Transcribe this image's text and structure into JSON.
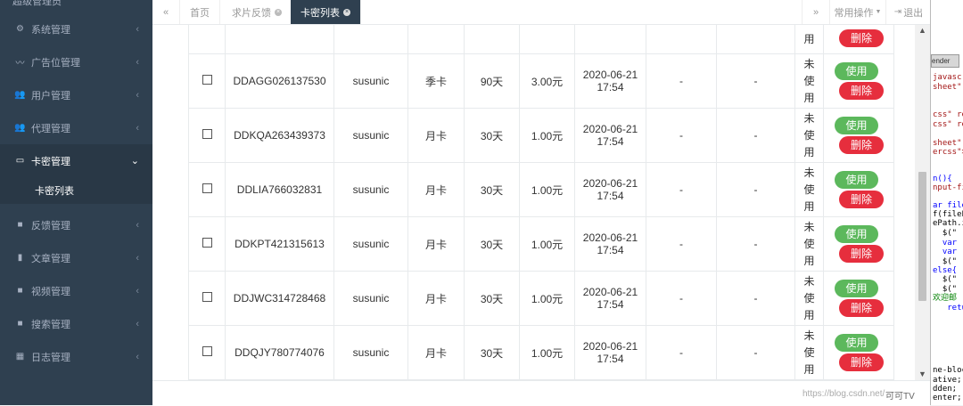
{
  "sidebar": {
    "logo_text": "超级管理员",
    "items": [
      {
        "label": "系统管理",
        "icon": "gears-icon"
      },
      {
        "label": "广告位管理",
        "icon": "rss-icon"
      },
      {
        "label": "用户管理",
        "icon": "users-icon"
      },
      {
        "label": "代理管理",
        "icon": "users-icon"
      },
      {
        "label": "卡密管理",
        "icon": "credit-card-icon"
      },
      {
        "label": "反馈管理",
        "icon": "video-icon"
      },
      {
        "label": "文章管理",
        "icon": "book-icon"
      },
      {
        "label": "视频管理",
        "icon": "video-icon"
      },
      {
        "label": "搜索管理",
        "icon": "video-icon"
      },
      {
        "label": "日志管理",
        "icon": "table-icon"
      }
    ],
    "sub_item": "卡密列表"
  },
  "topbar": {
    "prev_icon": "«",
    "next_icon": "»",
    "tabs": [
      "首页",
      "求片反馈",
      "卡密列表"
    ],
    "ops_label": "常用操作",
    "logout_label": "退出"
  },
  "table": {
    "first_row_partial": {
      "status": "用",
      "delete": "删除"
    },
    "rows": [
      {
        "code": "DDAGG026137530",
        "user": "susunic",
        "type": "季卡",
        "days": "90天",
        "price": "3.00元",
        "date": "2020-06-21",
        "time": "17:54",
        "c1": "-",
        "c2": "-",
        "status": [
          "未",
          "使",
          "用"
        ],
        "use": "使用",
        "delete": "删除"
      },
      {
        "code": "DDKQA263439373",
        "user": "susunic",
        "type": "月卡",
        "days": "30天",
        "price": "1.00元",
        "date": "2020-06-21",
        "time": "17:54",
        "c1": "-",
        "c2": "-",
        "status": [
          "未",
          "使",
          "用"
        ],
        "use": "使用",
        "delete": "删除"
      },
      {
        "code": "DDLIA766032831",
        "user": "susunic",
        "type": "月卡",
        "days": "30天",
        "price": "1.00元",
        "date": "2020-06-21",
        "time": "17:54",
        "c1": "-",
        "c2": "-",
        "status": [
          "未",
          "使",
          "用"
        ],
        "use": "使用",
        "delete": "删除"
      },
      {
        "code": "DDKPT421315613",
        "user": "susunic",
        "type": "月卡",
        "days": "30天",
        "price": "1.00元",
        "date": "2020-06-21",
        "time": "17:54",
        "c1": "-",
        "c2": "-",
        "status": [
          "未",
          "使",
          "用"
        ],
        "use": "使用",
        "delete": "删除"
      },
      {
        "code": "DDJWC314728468",
        "user": "susunic",
        "type": "月卡",
        "days": "30天",
        "price": "1.00元",
        "date": "2020-06-21",
        "time": "17:54",
        "c1": "-",
        "c2": "-",
        "status": [
          "未",
          "使",
          "用"
        ],
        "use": "使用",
        "delete": "删除"
      },
      {
        "code": "DDQJY780774076",
        "user": "susunic",
        "type": "月卡",
        "days": "30天",
        "price": "1.00元",
        "date": "2020-06-21",
        "time": "17:54",
        "c1": "-",
        "c2": "-",
        "status": [
          "未",
          "使",
          "用"
        ],
        "use": "使用",
        "delete": "删除"
      }
    ]
  },
  "editor": {
    "tab_label": "ender",
    "lines": [
      {
        "text": "javascr",
        "cls": "c-red"
      },
      {
        "text": "sheet\" t",
        "cls": "c-red"
      },
      {
        "text": "css\" re",
        "cls": "c-red"
      },
      {
        "text": "css\" re",
        "cls": "c-red"
      },
      {
        "text": "",
        "cls": "c-black"
      },
      {
        "text": "sheet\" h",
        "cls": "c-red"
      },
      {
        "text": "ercss\">",
        "cls": "c-red"
      },
      {
        "text": "n(){",
        "cls": "c-blue"
      },
      {
        "text": "nput-fi",
        "cls": "c-red"
      },
      {
        "text": "ar file",
        "cls": "c-blue"
      },
      {
        "text": "f(fileP",
        "cls": "c-black"
      },
      {
        "text": "ePath.i",
        "cls": "c-black"
      },
      {
        "text": "  $(\"",
        "cls": "c-black"
      },
      {
        "text": "  var ",
        "cls": "c-blue"
      },
      {
        "text": "  var ",
        "cls": "c-blue"
      },
      {
        "text": "  $(\"",
        "cls": "c-black"
      },
      {
        "text": "else{",
        "cls": "c-blue"
      },
      {
        "text": "  $(\"",
        "cls": "c-black"
      },
      {
        "text": "  $(\"",
        "cls": "c-black"
      },
      {
        "text": "欢迎邮",
        "cls": "c-green"
      },
      {
        "text": "   retu",
        "cls": "c-blue"
      },
      {
        "text": "ne-bloc",
        "cls": "c-black"
      },
      {
        "text": "ative;",
        "cls": "c-black"
      },
      {
        "text": "dden;",
        "cls": "c-black"
      },
      {
        "text": "enter;",
        "cls": "c-black"
      }
    ]
  },
  "watermark": "https://blog.csdn.net/",
  "watermark2": "可可TV"
}
